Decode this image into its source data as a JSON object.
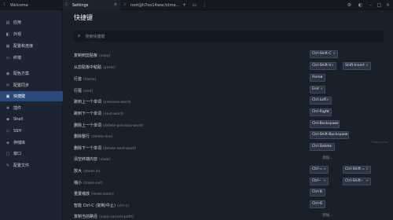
{
  "tabs": [
    {
      "num": "1",
      "label": "Welcome"
    },
    {
      "num": "2",
      "label": "Settings"
    },
    {
      "num": "3",
      "label": "root@h7oo14ww:/stma..."
    }
  ],
  "tab_icons": [
    "close-icon",
    "add-tab-icon",
    "split-icon",
    "menu-icon",
    "settings-icon",
    "profile-icon",
    "minimize-icon",
    "maximize-icon",
    "window-close-icon"
  ],
  "sidebar": {
    "items": [
      {
        "icon": "▤",
        "label": "应用"
      },
      {
        "icon": "◧",
        "label": "外观"
      },
      {
        "icon": "▦",
        "label": "配置和连接"
      },
      {
        "icon": "▭",
        "label": "终端"
      },
      {
        "icon": "◉",
        "label": "配色方案"
      },
      {
        "icon": "⟳",
        "label": "配置同步"
      },
      {
        "icon": "▣",
        "label": "快捷键"
      },
      {
        "icon": "✚",
        "label": "插件"
      },
      {
        "icon": "◆",
        "label": "Shell"
      },
      {
        "icon": "◇",
        "label": "SSH"
      },
      {
        "icon": "◈",
        "label": "存储库"
      },
      {
        "icon": "▢",
        "label": "窗口"
      },
      {
        "icon": "✎",
        "label": "配置文件"
      }
    ],
    "active_index": 6
  },
  "main": {
    "title": "快捷键",
    "search_placeholder": "搜索快捷键",
    "add_label": "添加...",
    "footnote": "©2023 Electra"
  },
  "hotkeys": [
    {
      "label": "复制到剪贴板",
      "cmd": "(copy)",
      "keys": [
        "Ctrl-Shift-C"
      ]
    },
    {
      "label": "从剪贴板中粘贴",
      "cmd": "(paste)",
      "keys": [
        "Ctrl-Shift-V",
        "Shift-Insert"
      ]
    },
    {
      "label": "行首",
      "cmd": "(home)",
      "keys": [
        "Home"
      ]
    },
    {
      "label": "行尾",
      "cmd": "(end)",
      "keys": [
        "End"
      ]
    },
    {
      "label": "跳到上一个单词",
      "cmd": "(previous-word)",
      "keys": [
        "Ctrl-Left"
      ]
    },
    {
      "label": "跳到下一个单词",
      "cmd": "(next-word)",
      "keys": [
        "Ctrl-Right"
      ]
    },
    {
      "label": "删除上一个单词",
      "cmd": "(delete-previous-word)",
      "keys": [
        "Ctrl-Backspace"
      ]
    },
    {
      "label": "删除整行",
      "cmd": "(delete-line)",
      "keys": [
        "Ctrl-Shift-Backspace"
      ]
    },
    {
      "label": "删除下一个单词",
      "cmd": "(delete-next-word)",
      "keys": [
        "Ctrl-Delete"
      ]
    },
    {
      "label": "清空终端内容",
      "cmd": "(clear)",
      "keys": [],
      "add": true
    },
    {
      "label": "放大",
      "cmd": "(zoom-in)",
      "keys": [
        "Ctrl-=",
        "Ctrl-Shift-="
      ]
    },
    {
      "label": "缩小",
      "cmd": "(zoom-out)",
      "keys": [
        "Ctrl--",
        "Ctrl-Shift--"
      ]
    },
    {
      "label": "重置缩放",
      "cmd": "(reset-zoom)",
      "keys": [
        "Ctrl-0"
      ]
    },
    {
      "label": "智能 Ctrl-C (复制/中止)",
      "cmd": "(ctrl-c)",
      "keys": [
        "Ctrl-C"
      ]
    },
    {
      "label": "复制当前路径",
      "cmd": "(copy-current-path)",
      "keys": [],
      "add": true
    }
  ]
}
